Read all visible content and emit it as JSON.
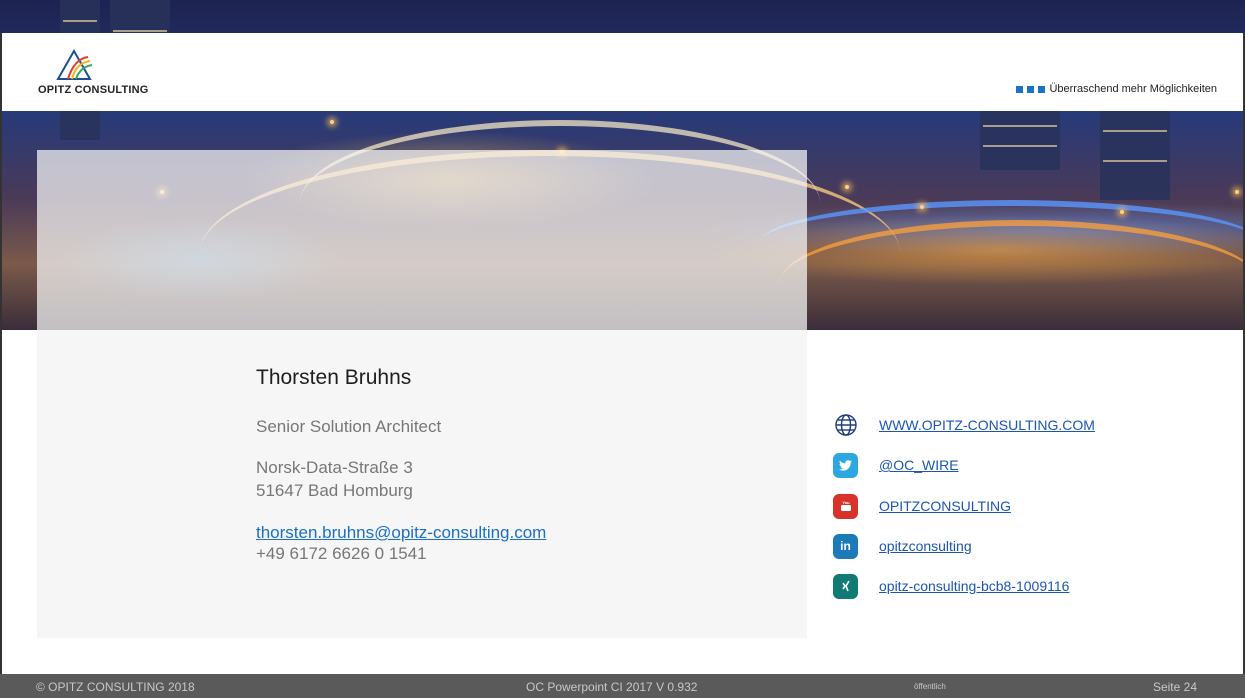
{
  "header": {
    "logo_text": "OPITZ CONSULTING",
    "tagline": "Überraschend mehr Möglichkeiten"
  },
  "contact": {
    "name": "Thorsten Bruhns",
    "role": "Senior Solution Architect",
    "address_line1": "Norsk-Data-Straße 3",
    "address_line2": "51647 Bad Homburg",
    "email": "thorsten.bruhns@opitz-consulting.com",
    "phone": "+49 6172 6626 0 1541"
  },
  "links": [
    {
      "icon": "globe-icon",
      "label": "WWW.OPITZ-CONSULTING.COM"
    },
    {
      "icon": "twitter-icon",
      "label": "@OC_WIRE",
      "glyph": "🐦"
    },
    {
      "icon": "youtube-icon",
      "label": "OPITZCONSULTING",
      "glyph": "▶"
    },
    {
      "icon": "linkedin-icon",
      "label": "opitzconsulting",
      "glyph": "in"
    },
    {
      "icon": "xing-icon",
      "label": "opitz-consulting-bcb8-1009116",
      "glyph": "✕"
    }
  ],
  "footer": {
    "copyright": "© OPITZ CONSULTING 2018",
    "version": "OC Powerpoint CI 2017 V 0.932",
    "classification": "öffentlich",
    "page": "Seite 24"
  },
  "colors": {
    "accent_blue": "#1a73c8",
    "link_blue": "#1a55b5",
    "twitter": "#2da7e0",
    "youtube": "#d8332b",
    "linkedin": "#1a7bb8",
    "xing": "#127a74",
    "footer_bg": "#5a5a5a"
  }
}
